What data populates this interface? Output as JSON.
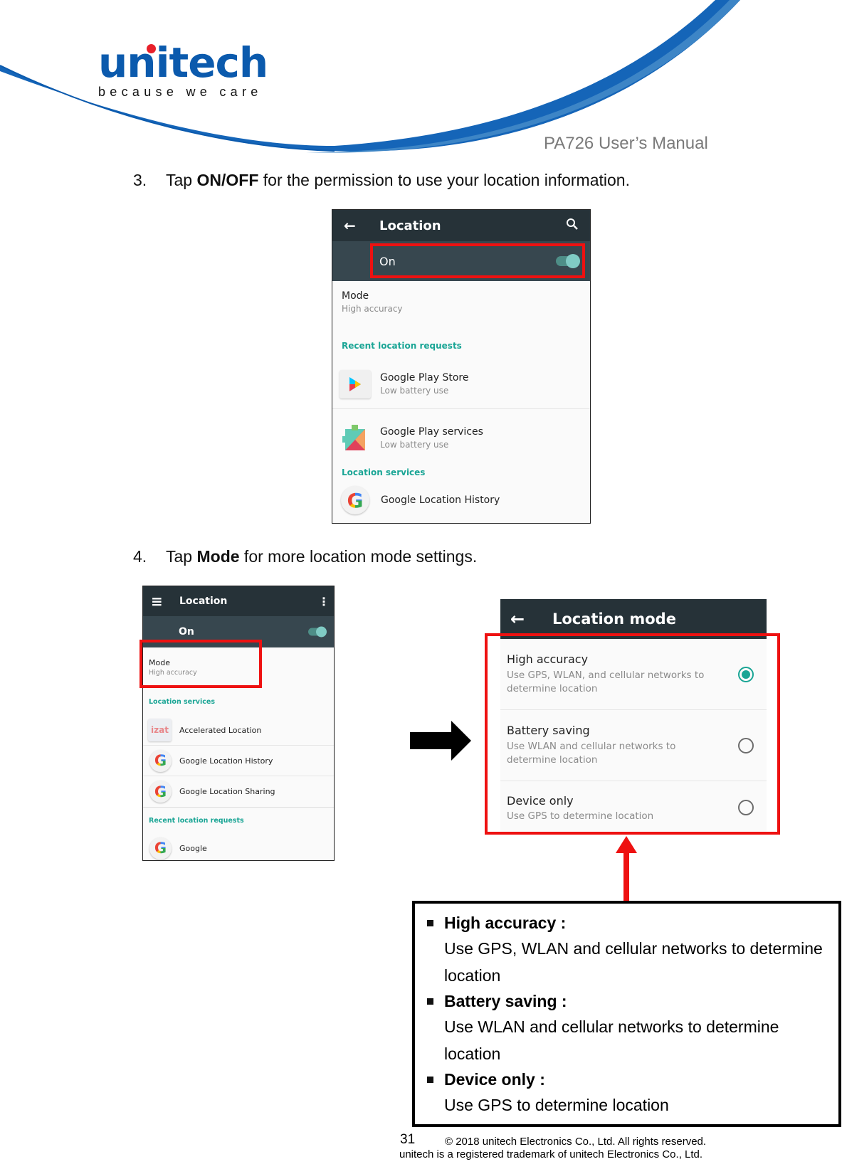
{
  "header": {
    "brand": "unitech",
    "tagline": "because we care",
    "manual_title": "PA726 User’s Manual",
    "colors": {
      "brand_blue": "#0b5aad",
      "brand_dot": "#e8202a"
    }
  },
  "steps": [
    {
      "number": "3.",
      "prefix": "Tap ",
      "bold": "ON/OFF",
      "suffix": " for the permission to use your location information."
    },
    {
      "number": "4.",
      "prefix": "Tap ",
      "bold": "Mode",
      "suffix": " for more location mode settings."
    }
  ],
  "screenshot1": {
    "title": "Location",
    "toggle_label": "On",
    "toggle_on": true,
    "mode_title": "Mode",
    "mode_value": "High accuracy",
    "section_recent": "Recent location requests",
    "recent": [
      {
        "icon": "google-play-store-icon",
        "title": "Google Play Store",
        "subtitle": "Low battery use"
      },
      {
        "icon": "google-play-services-icon",
        "title": "Google Play services",
        "subtitle": "Low battery use"
      }
    ],
    "section_services": "Location services",
    "services": [
      {
        "icon": "google-g-icon",
        "title": "Google Location History"
      }
    ]
  },
  "screenshot2": {
    "title": "Location",
    "toggle_label": "On",
    "toggle_on": true,
    "mode_title": "Mode",
    "mode_value": "High accuracy",
    "section_services": "Location services",
    "services": [
      {
        "icon": "accelerated-location-icon",
        "title": "Accelerated Location",
        "icon_text": "izat"
      },
      {
        "icon": "google-g-icon",
        "title": "Google Location History"
      },
      {
        "icon": "google-g-icon",
        "title": "Google Location Sharing"
      }
    ],
    "section_recent": "Recent location requests",
    "recent": [
      {
        "icon": "google-g-icon",
        "title": "Google"
      }
    ]
  },
  "screenshot3": {
    "title": "Location mode",
    "options": [
      {
        "title": "High accuracy",
        "subtitle": "Use GPS, WLAN, and cellular networks to determine location",
        "selected": true
      },
      {
        "title": "Battery saving",
        "subtitle": "Use WLAN and cellular networks to determine location",
        "selected": false
      },
      {
        "title": "Device only",
        "subtitle": "Use GPS to determine location",
        "selected": false
      }
    ]
  },
  "icons": {
    "back": "←",
    "search": "⌕",
    "menu": "≡",
    "overflow": "⋮",
    "google_g": "G"
  },
  "infobox": [
    {
      "heading": "High accuracy :",
      "description": "Use GPS, WLAN and cellular networks to determine location"
    },
    {
      "heading": "Battery saving :",
      "description": "Use WLAN and cellular networks to determine location"
    },
    {
      "heading": "Device only :",
      "description": "Use GPS to determine location"
    }
  ],
  "footer": {
    "page_number": "31",
    "copyright": "© 2018 unitech Electronics Co., Ltd. All rights reserved.",
    "trademark": "unitech is a registered trademark of unitech Electronics Co., Ltd."
  },
  "colors": {
    "highlight_red": "#ee1111",
    "teal_accent": "#1aa595",
    "appbar": "#263238",
    "togglebar": "#37474f"
  }
}
